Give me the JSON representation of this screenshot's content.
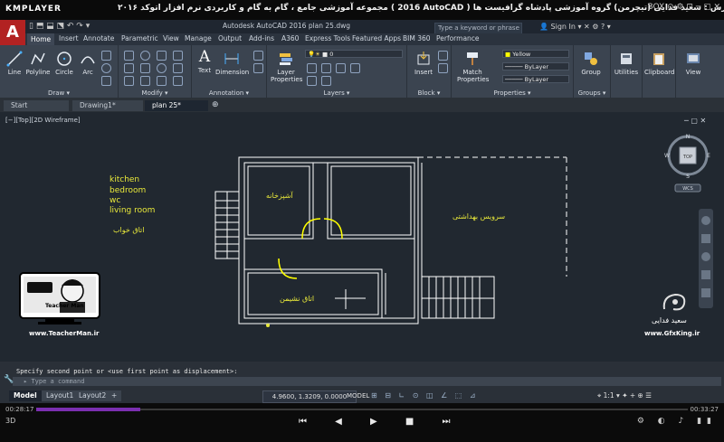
{
  "player": {
    "logo": "KMPLAYER",
    "title": "مجموعه آموزشی جامع ، گام به گام و کاربردی نرم افزار اتوکد ۲۰۱۶ ( 2016 AutoCAD ) مدرس : سعید فدایی (تیچرمن) گروه آموزشی پادشاه گرافیست ها",
    "controls": "BOX ⊙ ⚙ ⊡ ─ ▢ ✕",
    "time_elapsed": "00:28:17",
    "time_total": "00:33:27",
    "progress": 0.16,
    "left_info": "3D",
    "buttons": "⏮ ◀ ▶ ■ ⏭",
    "right_buttons": "⚙ ◐ ♪ ▮▮"
  },
  "autocad": {
    "logo": "A",
    "qat": "▯ ⬒ ⬓ ⬔ ↶ ↷ ▾",
    "document_title": "Autodesk AutoCAD 2016   plan 25.dwg",
    "search_placeholder": "Type a keyword or phrase",
    "signin": "Sign In",
    "tabs": [
      "Home",
      "Insert",
      "Annotate",
      "Parametric",
      "View",
      "Manage",
      "Output",
      "Add-ins",
      "A360",
      "Express Tools",
      "Featured Apps",
      "BIM 360",
      "Performance"
    ],
    "panels": {
      "draw": {
        "title": "Draw ▾",
        "tools": [
          "Line",
          "Polyline",
          "Circle",
          "Arc"
        ]
      },
      "modify": {
        "title": "Modify ▾"
      },
      "annotation": {
        "title": "Annotation ▾",
        "tools": [
          "Text",
          "Dimension"
        ]
      },
      "layers": {
        "title": "Layers ▾",
        "tool": "Layer Properties",
        "current_layer": "0"
      },
      "block": {
        "title": "Block ▾",
        "tool": "Insert"
      },
      "properties": {
        "title": "Properties ▾",
        "tool": "Match Properties",
        "color": "Yellow",
        "linetype": "ByLayer",
        "lineweight": "ByLayer"
      },
      "groups": {
        "title": "Groups ▾",
        "tool": "Group"
      },
      "utilities": {
        "tool": "Utilities"
      },
      "clipboard": {
        "tool": "Clipboard"
      },
      "view": {
        "tool": "View"
      }
    },
    "doc_tabs": [
      "Start",
      "Drawing1*",
      "plan 25*"
    ],
    "viewport_label": "[−][Top][2D Wireframe]",
    "viewcube": {
      "top": "TOP",
      "n": "N",
      "s": "S",
      "e": "E",
      "w": "W",
      "wcs": "WCS"
    },
    "legend_texts": [
      "kitchen",
      "bedroom",
      "wc",
      "living room"
    ],
    "legend_fa": "اتاق خواب",
    "room_labels": {
      "kitchen": "آشپزخانه",
      "bathroom": "سرویس بهداشتی",
      "living": "اتاق نشیمن"
    },
    "watermark_left_name": "Teacher Man",
    "watermark_left_site": "www.TeacherMan.ir",
    "watermark_right_name": "سعید فدایی",
    "watermark_right_site": "www.GfxKing.ir",
    "command_history": "Specify second point or <use first point as displacement>:",
    "command_placeholder": "Type a command",
    "layout_tabs": [
      "Model",
      "Layout1",
      "Layout2",
      "+"
    ],
    "coordinates": "4.9600, 1.3209, 0.0000",
    "model_label": "MODEL",
    "status_icons": "⊞ ⊟ ∟ ⊙ ◫ ∠ ⬚ ⊿",
    "scale": "⌖ 1:1 ▾ ✦ + ⊕ ☰"
  },
  "colors": {
    "accent": "#7b2fb0",
    "canvas": "#212830",
    "cad_yellow": "#e8e83a",
    "cad_white": "#ffffff"
  }
}
